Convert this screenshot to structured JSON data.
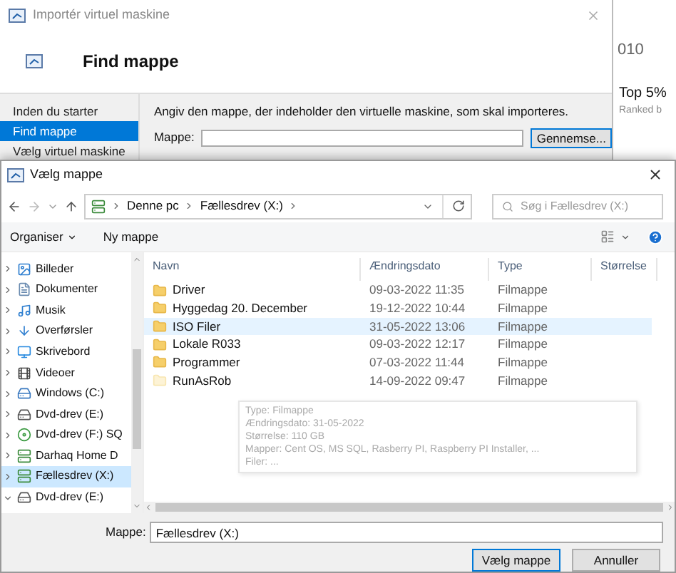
{
  "background": {
    "texts": [
      "010",
      "Top 5%",
      "Ranked b"
    ]
  },
  "import_dialog": {
    "title": "Importér virtuel maskine",
    "heading": "Find mappe",
    "nav": [
      {
        "label": "Inden du starter",
        "selected": false
      },
      {
        "label": "Find mappe",
        "selected": true
      },
      {
        "label": "Vælg virtuel maskine",
        "selected": false
      }
    ],
    "instruction": "Angiv den mappe, der indeholder den virtuelle maskine, som skal importeres.",
    "folder_label": "Mappe:",
    "browse_button": "Gennemse..."
  },
  "folder_dialog": {
    "title": "Vælg mappe",
    "breadcrumb": [
      "Denne pc",
      "Fællesdrev (X:)"
    ],
    "search": {
      "placeholder": "Søg i Fællesdrev (X:)"
    },
    "toolbar": [
      {
        "label": "Organiser",
        "kind": "menu"
      },
      {
        "label": "Ny mappe",
        "kind": "button"
      }
    ],
    "tree": [
      {
        "label": "Billeder",
        "kind": "pictures",
        "expanded": false,
        "selected": false
      },
      {
        "label": "Dokumenter",
        "kind": "documents",
        "expanded": false,
        "selected": false
      },
      {
        "label": "Musik",
        "kind": "music",
        "expanded": false,
        "selected": false
      },
      {
        "label": "Overførsler",
        "kind": "downloads",
        "expanded": false,
        "selected": false
      },
      {
        "label": "Skrivebord",
        "kind": "desktop",
        "expanded": false,
        "selected": false
      },
      {
        "label": "Videoer",
        "kind": "videos",
        "expanded": false,
        "selected": false
      },
      {
        "label": "Windows (C:)",
        "kind": "system",
        "expanded": false,
        "selected": false
      },
      {
        "label": "Dvd-drev (E:)",
        "kind": "dvd",
        "expanded": false,
        "selected": false
      },
      {
        "label": "Dvd-drev (F:) SQ",
        "kind": "disc",
        "expanded": false,
        "selected": false
      },
      {
        "label": "Darhaq Home D",
        "kind": "network",
        "expanded": false,
        "selected": false
      },
      {
        "label": "Fællesdrev (X:)",
        "kind": "network",
        "expanded": false,
        "selected": true
      },
      {
        "label": "Dvd-drev (E:)",
        "kind": "dvd",
        "expanded": true,
        "selected": false
      }
    ],
    "columns": [
      "Navn",
      "Ændringsdato",
      "Type",
      "Størrelse"
    ],
    "rows": [
      {
        "name": "Driver",
        "date": "09-03-2022 11:35",
        "type": "Filmappe",
        "selected": false,
        "faded": false
      },
      {
        "name": "Hyggedag 20. December",
        "date": "19-12-2022 10:44",
        "type": "Filmappe",
        "selected": false,
        "faded": false
      },
      {
        "name": "ISO Filer",
        "date": "31-05-2022 13:06",
        "type": "Filmappe",
        "selected": true,
        "faded": false
      },
      {
        "name": "Lokale R033",
        "date": "09-03-2022 12:17",
        "type": "Filmappe",
        "selected": false,
        "faded": false
      },
      {
        "name": "Programmer",
        "date": "07-03-2022 11:44",
        "type": "Filmappe",
        "selected": false,
        "faded": false
      },
      {
        "name": "RunAsRob",
        "date": "14-09-2022 09:47",
        "type": "Filmappe",
        "selected": false,
        "faded": true
      }
    ],
    "tooltip": [
      "Type: Filmappe",
      "Ændringsdato: 31-05-2022",
      "Størrelse: 110 GB",
      "Mapper: Cent OS, MS SQL, Rasberry PI, Raspberry PI Installer, ...",
      "Filer: ..."
    ],
    "folder_label": "Mappe:",
    "folder_value": "Fællesdrev (X:)",
    "buttons": [
      {
        "label": "Vælg mappe",
        "kind": "default"
      },
      {
        "label": "Annuller",
        "kind": "normal"
      }
    ]
  }
}
